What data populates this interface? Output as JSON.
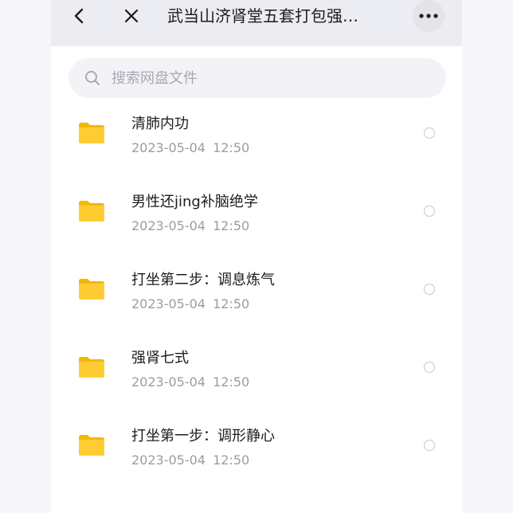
{
  "navbar": {
    "title": "武当山济肾堂五套打包强…",
    "back_icon": "chevron-left-icon",
    "close_icon": "close-icon",
    "more_icon": "more-horizontal-icon"
  },
  "search": {
    "placeholder": "搜索网盘文件",
    "value": ""
  },
  "colors": {
    "folder": "#ffcc33",
    "folder_tab": "#f5b800",
    "nav_bg": "#ececf3"
  },
  "files": [
    {
      "name": "清肺内功",
      "modified": "2023-05-04 12:50",
      "type": "folder-icon"
    },
    {
      "name": "男性还jing补脑绝学",
      "modified": "2023-05-04 12:50",
      "type": "folder-icon"
    },
    {
      "name": "打坐第二步：调息炼气",
      "modified": "2023-05-04 12:50",
      "type": "folder-icon"
    },
    {
      "name": "强肾七式",
      "modified": "2023-05-04 12:50",
      "type": "folder-icon"
    },
    {
      "name": "打坐第一步：调形静心",
      "modified": "2023-05-04 12:50",
      "type": "folder-icon"
    }
  ]
}
